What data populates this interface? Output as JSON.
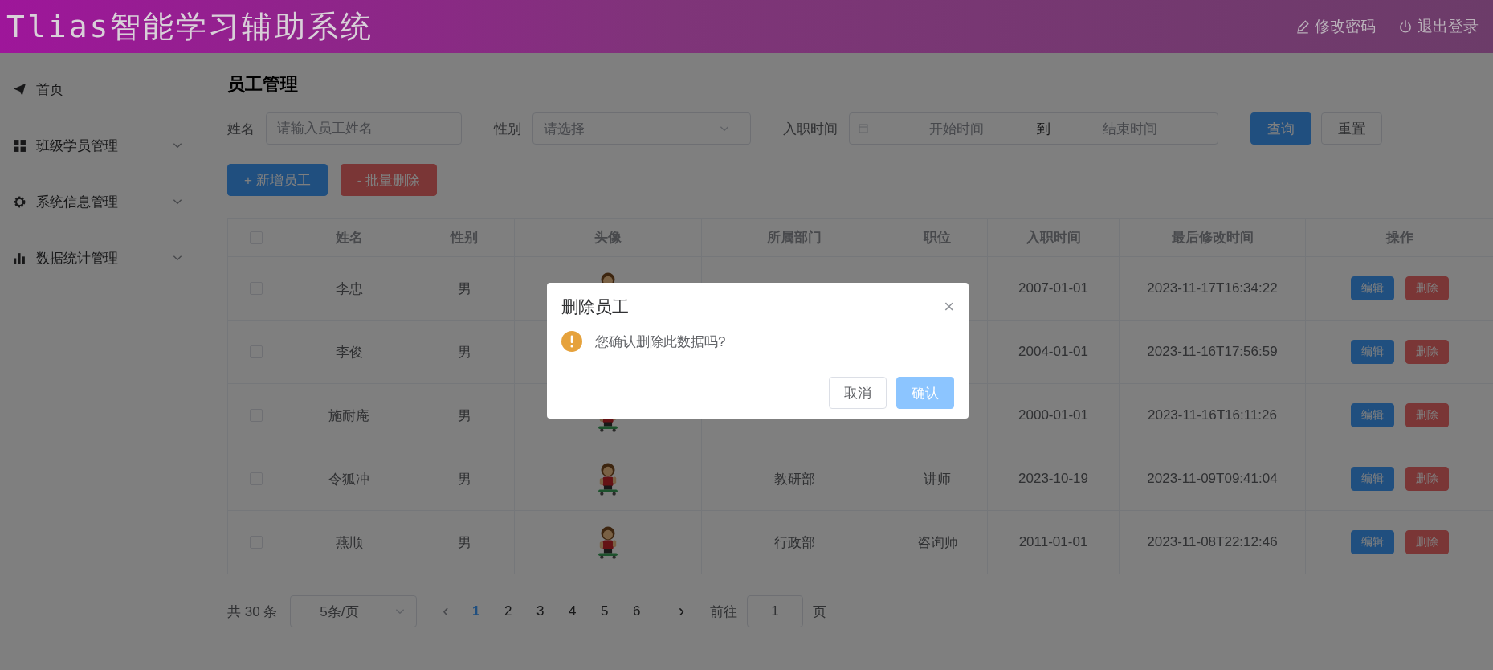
{
  "header": {
    "title": "Tlias智能学习辅助系统",
    "actions": [
      {
        "label": "修改密码"
      },
      {
        "label": "退出登录"
      }
    ]
  },
  "sidebar": {
    "items": [
      {
        "label": "首页"
      },
      {
        "label": "班级学员管理",
        "expanded": false
      },
      {
        "label": "系统信息管理",
        "expanded": false
      },
      {
        "label": "数据统计管理",
        "expanded": false
      }
    ]
  },
  "page_title": "员工管理",
  "filters": {
    "name": {
      "label": "姓名",
      "placeholder": "请输入员工姓名"
    },
    "gender": {
      "label": "性别",
      "placeholder": "请选择"
    },
    "hire_date": {
      "label": "入职时间",
      "start_placeholder": "开始时间",
      "separator": "到",
      "end_placeholder": "结束时间"
    },
    "buttons": [
      {
        "label": "查询",
        "kind": "primary"
      },
      {
        "label": "重置",
        "kind": "plain"
      }
    ]
  },
  "actions": [
    {
      "label": "+ 新增员工",
      "kind": "primary"
    },
    {
      "label": "- 批量删除",
      "kind": "danger"
    }
  ],
  "table": {
    "all_checked": false,
    "columns": [
      "姓名",
      "性别",
      "头像",
      "所属部门",
      "职位",
      "入职时间",
      "最后修改时间",
      "操作"
    ],
    "rows": [
      {
        "checked": false,
        "name": "李忠",
        "gender": "男",
        "hire_date": "2007-01-01",
        "updated": "2023-11-17T16:34:22",
        "edit": "编辑",
        "delete": "删除"
      },
      {
        "checked": false,
        "name": "李俊",
        "gender": "男",
        "hire_date": "2004-01-01",
        "updated": "2023-11-16T17:56:59",
        "edit": "编辑",
        "delete": "删除"
      },
      {
        "checked": false,
        "name": "施耐庵",
        "gender": "男",
        "hire_date": "2000-01-01",
        "updated": "2023-11-16T16:11:26",
        "edit": "编辑",
        "delete": "删除"
      },
      {
        "checked": false,
        "name": "令狐冲",
        "gender": "男",
        "department": "教研部",
        "position": "讲师",
        "hire_date": "2023-10-19",
        "updated": "2023-11-09T09:41:04",
        "edit": "编辑",
        "delete": "删除"
      },
      {
        "checked": false,
        "name": "燕顺",
        "gender": "男",
        "department": "行政部",
        "position": "咨询师",
        "hire_date": "2011-01-01",
        "updated": "2023-11-08T22:12:46",
        "edit": "编辑",
        "delete": "删除"
      }
    ]
  },
  "pagination": {
    "total": "共 30 条",
    "page_size": "5条/页",
    "pages": [
      {
        "label": "1",
        "selected": true
      },
      {
        "label": "2",
        "selected": false
      },
      {
        "label": "3",
        "selected": false
      },
      {
        "label": "4",
        "selected": false
      },
      {
        "label": "5",
        "selected": false
      },
      {
        "label": "6",
        "selected": false
      }
    ],
    "prev": "‹",
    "next": "›",
    "goto_label": "前往",
    "goto_value": "1",
    "goto_suffix": "页"
  },
  "dialog": {
    "title": "删除员工",
    "close": "×",
    "message": "您确认删除此数据吗?",
    "buttons": [
      {
        "label": "取消",
        "kind": "plain"
      },
      {
        "label": "确认",
        "kind": "primary"
      }
    ]
  }
}
